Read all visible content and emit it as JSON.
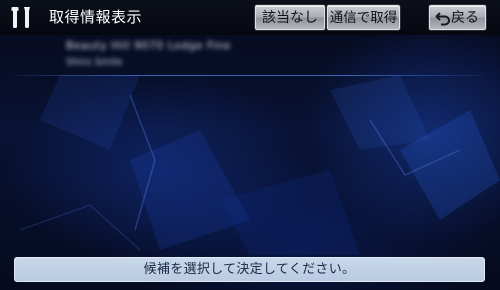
{
  "header": {
    "title": "取得情報表示",
    "tools_icon": "wrench-screwdriver-icon"
  },
  "buttons": {
    "none_label": "該当なし",
    "comm_label": "通信で取得",
    "back_label": "戻る",
    "back_icon": "return-arrow-icon"
  },
  "result": {
    "name": "Beauty Hill 9070 Lodge Fine",
    "subtitle": "Shiro Smile"
  },
  "message": {
    "text": "候補を選択して決定してください。"
  }
}
